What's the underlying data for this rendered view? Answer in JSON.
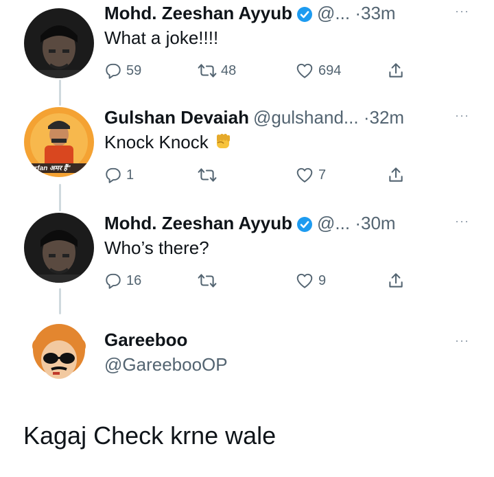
{
  "tweets": [
    {
      "name": "Mohd. Zeeshan Ayyub",
      "verified": true,
      "handle": "@...",
      "dot": "·",
      "time": "33m",
      "more": "···",
      "text": "What a joke!!!!",
      "replies": "59",
      "retweets": "48",
      "likes": "694"
    },
    {
      "name": "Gulshan Devaiah",
      "verified": false,
      "handle": "@gulshand...",
      "dot": "·",
      "time": "32m",
      "more": "···",
      "text": "Knock Knock",
      "emoji": "raised-fist",
      "avatar_caption": "\"Irrfan अमर हैं\"",
      "replies": "1",
      "retweets": "",
      "likes": "7"
    },
    {
      "name": "Mohd. Zeeshan Ayyub",
      "verified": true,
      "handle": "@...",
      "dot": "·",
      "time": "30m",
      "more": "···",
      "text": "Who’s there?",
      "replies": "16",
      "retweets": "",
      "likes": "9"
    }
  ],
  "reply": {
    "name": "Gareeboo",
    "handle": "@GareebooOP",
    "more": "···",
    "text": "Kagaj Check krne wale"
  },
  "colors": {
    "verified": "#1d9bf0",
    "muted": "#536471",
    "thread_line": "#cfd9de"
  }
}
